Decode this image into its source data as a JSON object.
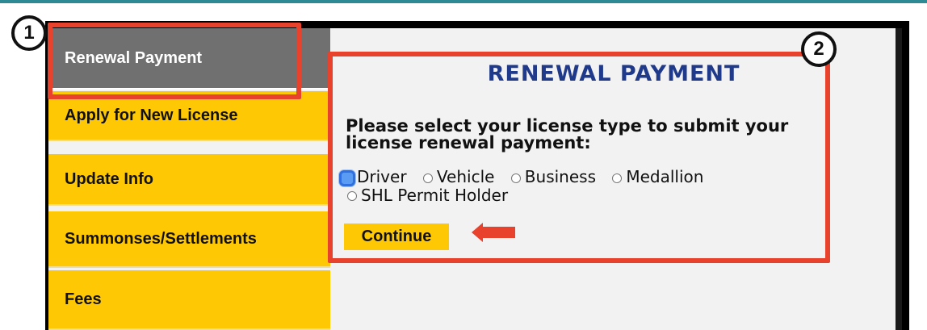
{
  "sidebar": {
    "items": [
      {
        "label": "Renewal Payment"
      },
      {
        "label": "Apply for New License"
      },
      {
        "label": "Update Info"
      },
      {
        "label": "Summonses/Settlements"
      },
      {
        "label": "Fees"
      }
    ],
    "active_index": 0
  },
  "panel": {
    "title": "RENEWAL PAYMENT",
    "prompt": "Please select your license type to submit your license renewal payment:",
    "options": [
      "Driver",
      "Vehicle",
      "Business",
      "Medallion",
      "SHL Permit Holder"
    ],
    "selected": "Driver",
    "continue_label": "Continue"
  },
  "annotations": {
    "badge_1": "1",
    "badge_2": "2",
    "highlight_color": "#e8412c"
  },
  "colors": {
    "nav_yellow": "#ffc805",
    "nav_active": "#707070",
    "title_blue": "#1f3a8a",
    "radio_selected": "#2f6fde"
  }
}
